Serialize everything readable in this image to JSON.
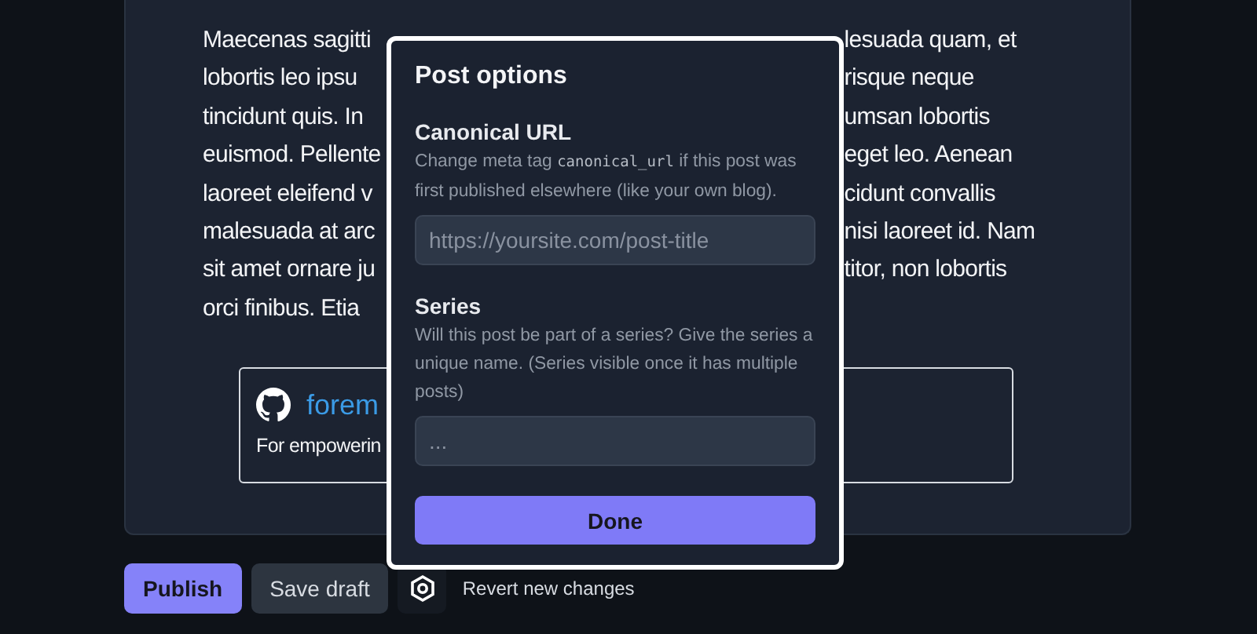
{
  "article": {
    "lines": [
      {
        "left": "Maecenas sagitti",
        "right": "lesuada quam, et"
      },
      {
        "left": "lobortis leo ipsu",
        "right": "risque neque"
      },
      {
        "left": "tincidunt quis. In",
        "right": "umsan lobortis"
      },
      {
        "left": "euismod. Pellente",
        "right": "eget leo. Aenean"
      },
      {
        "left": "laoreet eleifend v",
        "right": "cidunt convallis"
      },
      {
        "left": "malesuada at arc",
        "right": "nisi laoreet id. Nam"
      },
      {
        "left": "sit amet ornare ju",
        "right": "titor, non lobortis"
      },
      {
        "left": "orci finibus. Etia"
      }
    ],
    "embed": {
      "repo": "forem",
      "description": "For empowerin"
    }
  },
  "modal": {
    "title": "Post options",
    "fields": [
      {
        "label": "Canonical URL",
        "help": [
          {
            "kind": "text",
            "text": "Change meta tag "
          },
          {
            "kind": "code",
            "text": "canonical_url"
          },
          {
            "kind": "text",
            "text": " if this post was first published elsewhere (like your own blog)."
          }
        ],
        "placeholder": "https://yoursite.com/post-title"
      },
      {
        "label": "Series",
        "help": [
          {
            "kind": "text",
            "text": "Will this post be part of a series? Give the series a unique name. (Series visible once it has multiple posts)"
          }
        ],
        "placeholder": "..."
      }
    ],
    "done": "Done"
  },
  "actions": {
    "publish": "Publish",
    "save_draft": "Save draft",
    "revert": "Revert new changes"
  }
}
